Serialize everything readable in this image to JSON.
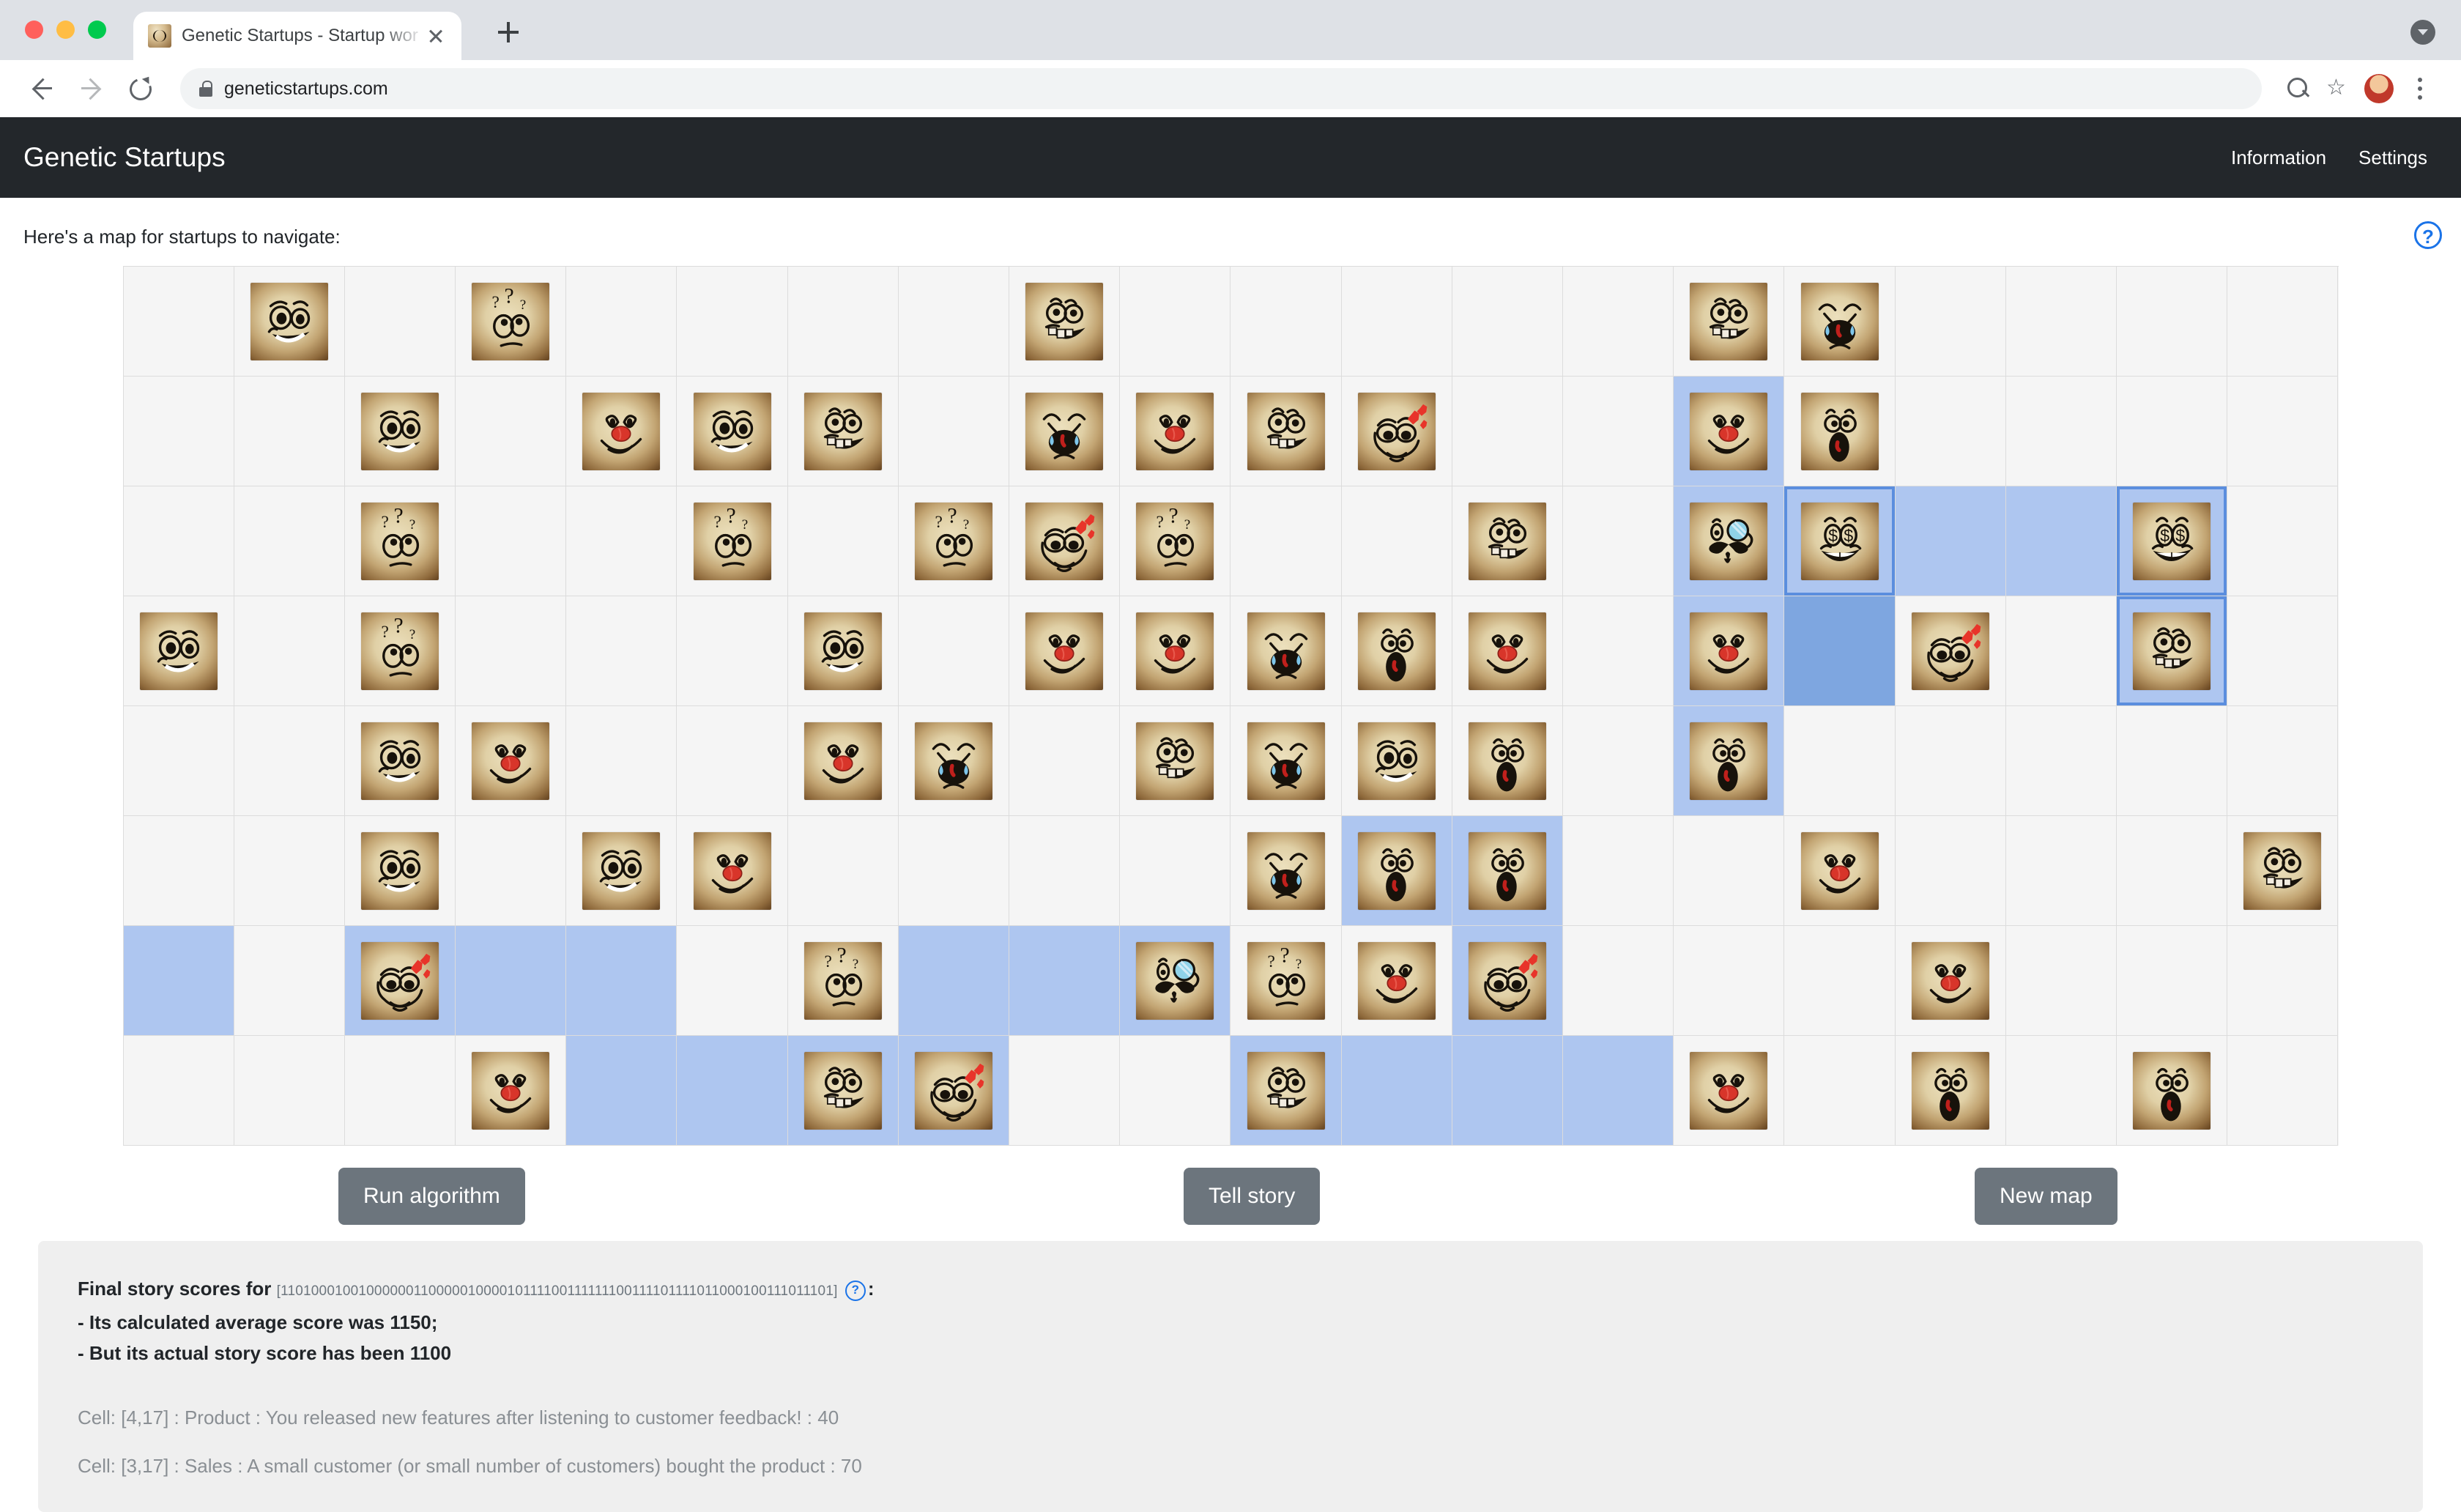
{
  "browser": {
    "tab_title": "Genetic Startups - Startup wor",
    "url": "geneticstartups.com",
    "favicon_name": "genetic-startups-favicon",
    "new_tab_label": "+",
    "close_label": "×"
  },
  "app": {
    "brand": "Genetic Startups",
    "nav": [
      {
        "label": "Information",
        "name": "nav-information"
      },
      {
        "label": "Settings",
        "name": "nav-settings"
      }
    ],
    "intro": "Here's a map for startups to navigate:",
    "help_icon_label": "?"
  },
  "buttons": {
    "run": "Run algorithm",
    "tell": "Tell story",
    "new_map": "New map"
  },
  "log": {
    "title_prefix": "Final story scores for",
    "genome": "[1101000100100000011000001000010111100111111100111101111011000100111011101]",
    "help_label": "?",
    "colon": ":",
    "line_avg": "- Its calculated average score was 1150;",
    "line_actual": "- But its actual story score has been 1100",
    "cells": [
      "Cell: [4,17] : Product : You released new features after listening to customer feedback! : 40",
      "Cell: [3,17] : Sales : A small customer (or small number of customers) bought the product : 70"
    ]
  },
  "colors": {
    "accent_blue": "#1a73e8",
    "header_dark": "#23272b",
    "button_grey": "#6c757d",
    "highlight_light": "#aec6f0",
    "highlight_strong": "#5b8ede",
    "highlight_fill": "#7ea6e0",
    "panel_bg": "#efefef"
  },
  "grid": {
    "rows": 8,
    "cols": 20,
    "face_types": {
      "smirk": "smirk-face",
      "confused": "confused-face",
      "clown": "clown-face",
      "toothy": "toothy-grin-face",
      "crying": "crying-face",
      "shocked": "shocked-face",
      "love": "love-eyes-face",
      "money": "money-eyes-face",
      "monocle": "monocle-face"
    },
    "cells": [
      [
        {
          "f": "none",
          "h": 0
        },
        {
          "f": "smirk",
          "h": 0
        },
        {
          "f": "none",
          "h": 0
        },
        {
          "f": "confused",
          "h": 0
        },
        {
          "f": "none",
          "h": 0
        },
        {
          "f": "none",
          "h": 0
        },
        {
          "f": "none",
          "h": 0
        },
        {
          "f": "none",
          "h": 0
        },
        {
          "f": "toothy",
          "h": 0
        },
        {
          "f": "none",
          "h": 0
        },
        {
          "f": "none",
          "h": 0
        },
        {
          "f": "none",
          "h": 0
        },
        {
          "f": "none",
          "h": 0
        },
        {
          "f": "none",
          "h": 0
        },
        {
          "f": "toothy",
          "h": 0
        },
        {
          "f": "crying",
          "h": 0
        },
        {
          "f": "none",
          "h": 0
        },
        {
          "f": "none",
          "h": 0
        },
        {
          "f": "none",
          "h": 0
        },
        {
          "f": "none",
          "h": 0
        }
      ],
      [
        {
          "f": "none",
          "h": 0
        },
        {
          "f": "none",
          "h": 0
        },
        {
          "f": "smirk",
          "h": 0
        },
        {
          "f": "none",
          "h": 0
        },
        {
          "f": "clown",
          "h": 0
        },
        {
          "f": "smirk",
          "h": 0
        },
        {
          "f": "toothy",
          "h": 0
        },
        {
          "f": "none",
          "h": 0
        },
        {
          "f": "crying",
          "h": 0
        },
        {
          "f": "clown",
          "h": 0
        },
        {
          "f": "toothy",
          "h": 0
        },
        {
          "f": "love",
          "h": 0
        },
        {
          "f": "none",
          "h": 0
        },
        {
          "f": "none",
          "h": 0
        },
        {
          "f": "clown",
          "h": 1
        },
        {
          "f": "shocked",
          "h": 0
        },
        {
          "f": "none",
          "h": 0
        },
        {
          "f": "none",
          "h": 0
        },
        {
          "f": "none",
          "h": 0
        },
        {
          "f": "none",
          "h": 0
        }
      ],
      [
        {
          "f": "none",
          "h": 0
        },
        {
          "f": "none",
          "h": 0
        },
        {
          "f": "confused",
          "h": 0
        },
        {
          "f": "none",
          "h": 0
        },
        {
          "f": "none",
          "h": 0
        },
        {
          "f": "confused",
          "h": 0
        },
        {
          "f": "none",
          "h": 0
        },
        {
          "f": "confused",
          "h": 0
        },
        {
          "f": "love",
          "h": 0
        },
        {
          "f": "confused",
          "h": 0
        },
        {
          "f": "none",
          "h": 0
        },
        {
          "f": "none",
          "h": 0
        },
        {
          "f": "toothy",
          "h": 0
        },
        {
          "f": "none",
          "h": 0
        },
        {
          "f": "monocle",
          "h": 1
        },
        {
          "f": "money",
          "h": 2
        },
        {
          "f": "none",
          "h": 1
        },
        {
          "f": "none",
          "h": 1
        },
        {
          "f": "money",
          "h": 2
        },
        {
          "f": "none",
          "h": 0
        }
      ],
      [
        {
          "f": "smirk",
          "h": 0
        },
        {
          "f": "none",
          "h": 0
        },
        {
          "f": "confused",
          "h": 0
        },
        {
          "f": "none",
          "h": 0
        },
        {
          "f": "none",
          "h": 0
        },
        {
          "f": "none",
          "h": 0
        },
        {
          "f": "smirk",
          "h": 0
        },
        {
          "f": "none",
          "h": 0
        },
        {
          "f": "clown",
          "h": 0
        },
        {
          "f": "clown",
          "h": 0
        },
        {
          "f": "crying",
          "h": 0
        },
        {
          "f": "shocked",
          "h": 0
        },
        {
          "f": "clown",
          "h": 0
        },
        {
          "f": "none",
          "h": 0
        },
        {
          "f": "clown",
          "h": 1
        },
        {
          "f": "none",
          "h": 3
        },
        {
          "f": "love",
          "h": 0
        },
        {
          "f": "none",
          "h": 0
        },
        {
          "f": "toothy",
          "h": 2
        },
        {
          "f": "none",
          "h": 0
        }
      ],
      [
        {
          "f": "none",
          "h": 0
        },
        {
          "f": "none",
          "h": 0
        },
        {
          "f": "smirk",
          "h": 0
        },
        {
          "f": "clown",
          "h": 0
        },
        {
          "f": "none",
          "h": 0
        },
        {
          "f": "none",
          "h": 0
        },
        {
          "f": "clown",
          "h": 0
        },
        {
          "f": "crying",
          "h": 0
        },
        {
          "f": "none",
          "h": 0
        },
        {
          "f": "toothy",
          "h": 0
        },
        {
          "f": "crying",
          "h": 0
        },
        {
          "f": "smirk",
          "h": 0
        },
        {
          "f": "shocked",
          "h": 0
        },
        {
          "f": "none",
          "h": 0
        },
        {
          "f": "shocked",
          "h": 1
        },
        {
          "f": "none",
          "h": 0
        },
        {
          "f": "none",
          "h": 0
        },
        {
          "f": "none",
          "h": 0
        },
        {
          "f": "none",
          "h": 0
        },
        {
          "f": "none",
          "h": 0
        }
      ],
      [
        {
          "f": "none",
          "h": 0
        },
        {
          "f": "none",
          "h": 0
        },
        {
          "f": "smirk",
          "h": 0
        },
        {
          "f": "none",
          "h": 0
        },
        {
          "f": "smirk",
          "h": 0
        },
        {
          "f": "clown",
          "h": 0
        },
        {
          "f": "none",
          "h": 0
        },
        {
          "f": "none",
          "h": 0
        },
        {
          "f": "none",
          "h": 0
        },
        {
          "f": "none",
          "h": 0
        },
        {
          "f": "crying",
          "h": 0
        },
        {
          "f": "shocked",
          "h": 1
        },
        {
          "f": "shocked",
          "h": 1
        },
        {
          "f": "none",
          "h": 0
        },
        {
          "f": "none",
          "h": 0
        },
        {
          "f": "clown",
          "h": 0
        },
        {
          "f": "none",
          "h": 0
        },
        {
          "f": "none",
          "h": 0
        },
        {
          "f": "none",
          "h": 0
        },
        {
          "f": "toothy",
          "h": 0
        }
      ],
      [
        {
          "f": "none",
          "h": 1
        },
        {
          "f": "none",
          "h": 0
        },
        {
          "f": "love",
          "h": 1
        },
        {
          "f": "none",
          "h": 1
        },
        {
          "f": "none",
          "h": 1
        },
        {
          "f": "none",
          "h": 0
        },
        {
          "f": "confused",
          "h": 0
        },
        {
          "f": "none",
          "h": 1
        },
        {
          "f": "none",
          "h": 1
        },
        {
          "f": "monocle",
          "h": 1
        },
        {
          "f": "confused",
          "h": 0
        },
        {
          "f": "clown",
          "h": 0
        },
        {
          "f": "love",
          "h": 1
        },
        {
          "f": "none",
          "h": 0
        },
        {
          "f": "none",
          "h": 0
        },
        {
          "f": "none",
          "h": 0
        },
        {
          "f": "clown",
          "h": 0
        },
        {
          "f": "none",
          "h": 0
        },
        {
          "f": "none",
          "h": 0
        },
        {
          "f": "none",
          "h": 0
        }
      ],
      [
        {
          "f": "none",
          "h": 0
        },
        {
          "f": "none",
          "h": 0
        },
        {
          "f": "none",
          "h": 0
        },
        {
          "f": "clown",
          "h": 0
        },
        {
          "f": "none",
          "h": 1
        },
        {
          "f": "none",
          "h": 1
        },
        {
          "f": "toothy",
          "h": 1
        },
        {
          "f": "love",
          "h": 1
        },
        {
          "f": "none",
          "h": 0
        },
        {
          "f": "none",
          "h": 0
        },
        {
          "f": "toothy",
          "h": 1
        },
        {
          "f": "none",
          "h": 1
        },
        {
          "f": "none",
          "h": 1
        },
        {
          "f": "none",
          "h": 1
        },
        {
          "f": "clown",
          "h": 0
        },
        {
          "f": "none",
          "h": 0
        },
        {
          "f": "shocked",
          "h": 0
        },
        {
          "f": "none",
          "h": 0
        },
        {
          "f": "shocked",
          "h": 0
        },
        {
          "f": "none",
          "h": 0
        }
      ]
    ]
  }
}
